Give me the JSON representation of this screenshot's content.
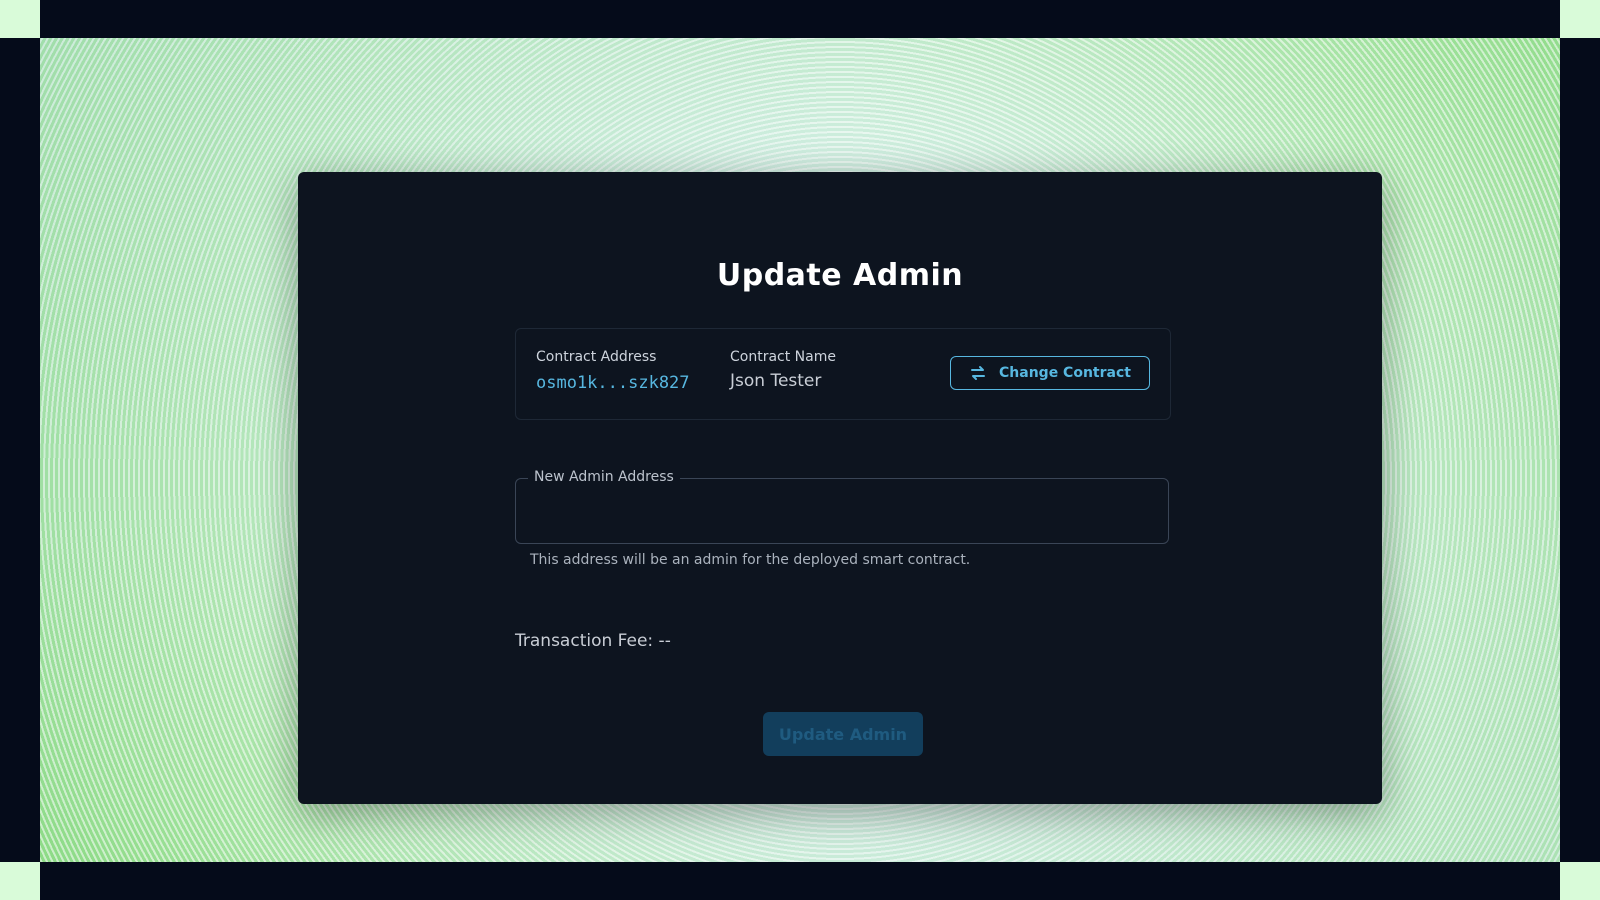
{
  "page": {
    "title": "Update Admin"
  },
  "contract": {
    "address_label": "Contract Address",
    "address_value": "osmo1k...szk827",
    "name_label": "Contract Name",
    "name_value": "Json Tester",
    "change_button_label": "Change Contract",
    "change_button_icon": "swap-arrows-icon"
  },
  "admin_field": {
    "label": "New Admin Address",
    "value": "",
    "helper_text": "This address will be an admin for the deployed smart contract."
  },
  "fee": {
    "text": "Transaction Fee: --"
  },
  "submit": {
    "label": "Update Admin",
    "disabled": true
  },
  "colors": {
    "accent": "#57b7e0",
    "card_background": "#0d141f",
    "page_background": "#050b1a",
    "submit_disabled_bg": "#123e5c"
  }
}
